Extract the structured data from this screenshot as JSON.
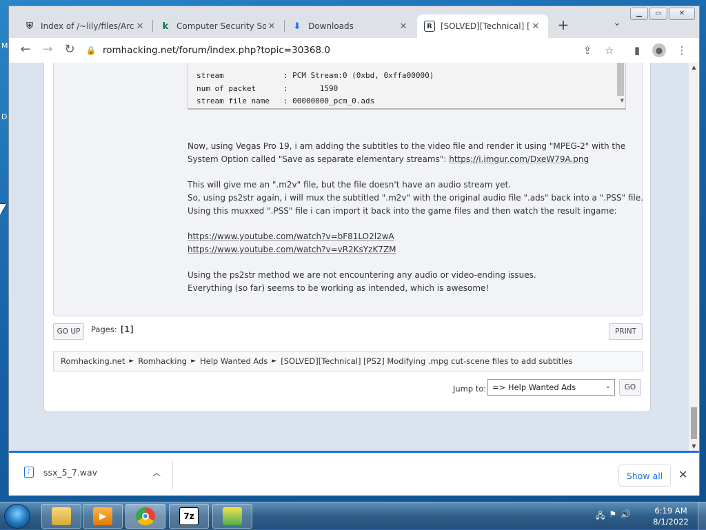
{
  "browser": {
    "tabs": [
      {
        "title": "Index of /~lily/files/Arch",
        "icon": "shield-favicon"
      },
      {
        "title": "Computer Security Softw",
        "icon": "k-favicon"
      },
      {
        "title": "Downloads",
        "icon": "download-favicon"
      },
      {
        "title": "[SOLVED][Technical] [PS",
        "icon": "r-favicon"
      }
    ],
    "url": "romhacking.net/forum/index.php?topic=30368.0"
  },
  "page": {
    "code_lines": [
      "stream             : PCM Stream:0 (0xbd, 0xffa00000)",
      "num of packet      :       1590",
      "stream file name   : 00000000_pcm_0.ads"
    ],
    "para1_line1": "Now, using Vegas Pro 19, i am adding the subtitles to the video file and render it using \"MPEG-2\" with the",
    "para1_line2_text": "System Option called \"Save as separate elementary streams\": ",
    "para1_link": "https://i.imgur.com/DxeW79A.png",
    "para2_line1": "This will give me an \".m2v\" file, but the file doesn't have an audio stream yet.",
    "para2_line2": "So, using ps2str again, i will mux the subtitled \".m2v\" with the original audio file \".ads\" back into a \".PSS\" file.",
    "para2_line3": "Using this muxxed \".PSS\" file i can import it back into the game files and then watch the result ingame:",
    "link1": "https://www.youtube.com/watch?v=bF81LO2l2wA",
    "link2": "https://www.youtube.com/watch?v=vR2KsYzK7ZM",
    "para3_line1": "Using the ps2str method we are not encountering any audio or video-ending issues.",
    "para3_line2": "Everything (so far) seems to be working as intended, which is awesome!",
    "go_up": "GO UP",
    "pages_label": "Pages:",
    "pages_value": "[1]",
    "print": "PRINT",
    "breadcrumb": [
      "Romhacking.net",
      "Romhacking",
      "Help Wanted Ads",
      "[SOLVED][Technical] [PS2] Modifying .mpg cut-scene files to add subtitles"
    ],
    "breadcrumb_sep": "►",
    "jump_label": "Jump to:",
    "jump_value": "=> Help Wanted Ads",
    "go": "GO"
  },
  "downloads": {
    "file": "ssx_5_7.wav",
    "show_all": "Show all"
  },
  "taskbar": {
    "time": "6:19 AM",
    "date": "8/1/2022",
    "apps": [
      "explorer",
      "media-player",
      "chrome",
      "7zip",
      "app-green"
    ]
  },
  "desktop": {
    "letters": [
      "M",
      "D"
    ]
  },
  "colors": {
    "accent": "#1a73e8",
    "forum_bg": "#dbe3ee"
  }
}
